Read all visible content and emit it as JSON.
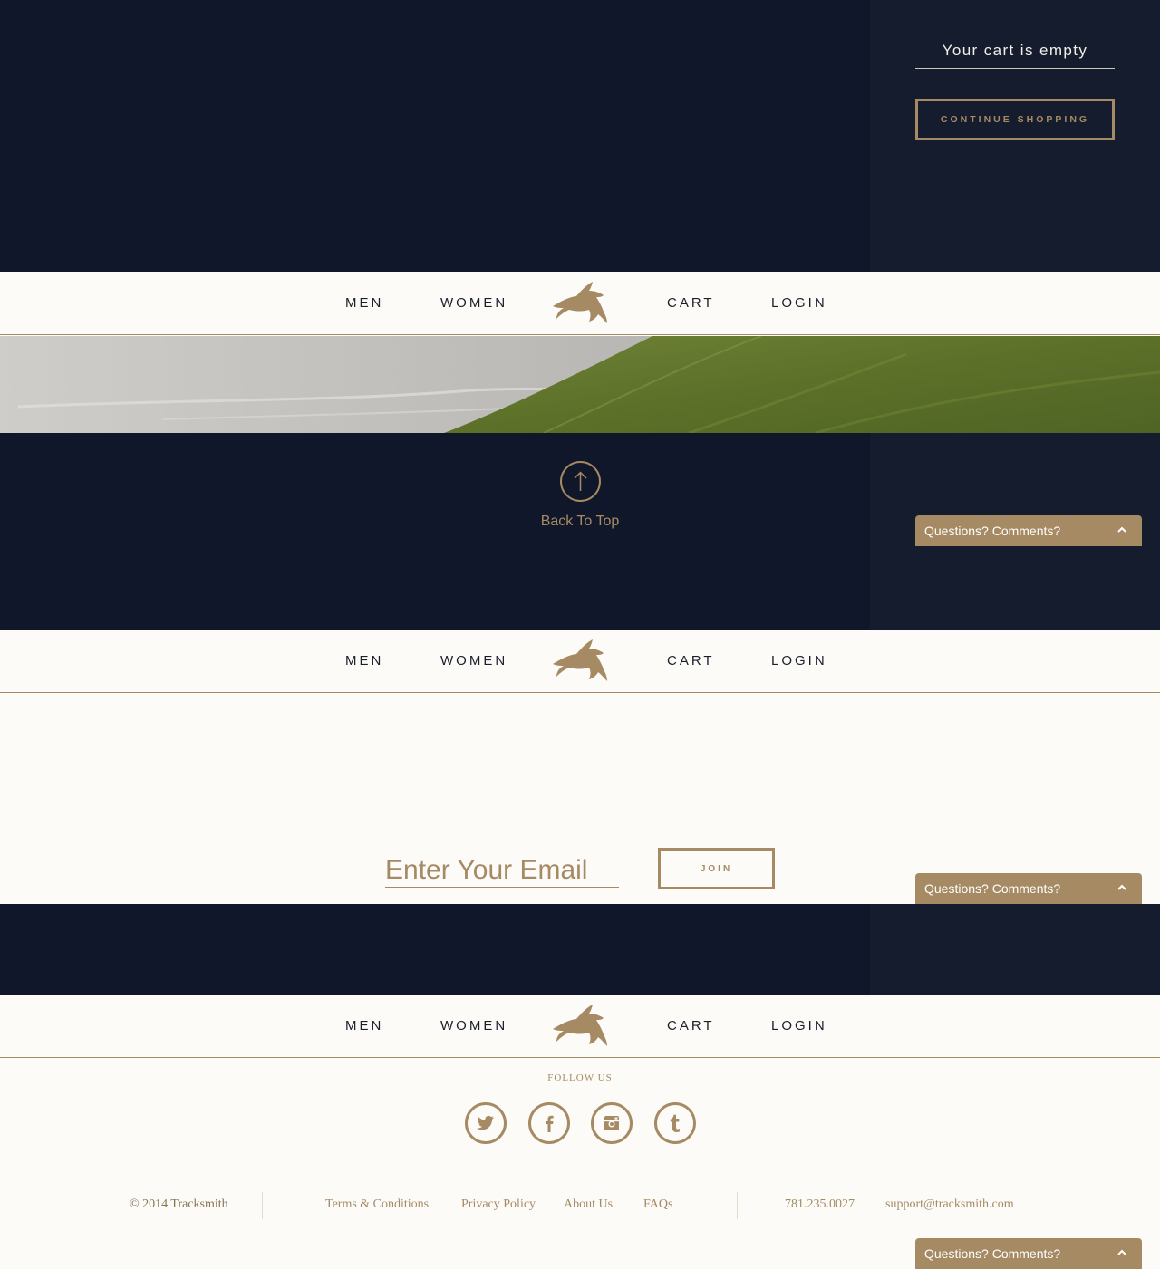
{
  "cart": {
    "empty_message": "Your cart is empty",
    "continue_label": "CONTINUE SHOPPING"
  },
  "nav": {
    "men": "MEN",
    "women": "WOMEN",
    "cart": "CART",
    "login": "LOGIN",
    "logo_icon": "leaping-hare-logo"
  },
  "back_to_top": {
    "label": "Back To Top",
    "icon": "arrow-up-circle-icon"
  },
  "feedback_widget": {
    "label": "Questions? Comments?",
    "icon": "chevron-up-icon"
  },
  "newsletter": {
    "placeholder": "Enter Your Email",
    "join_label": "JOIN"
  },
  "footer": {
    "follow_label": "FOLLOW US",
    "social": [
      {
        "name": "twitter",
        "icon": "twitter-icon"
      },
      {
        "name": "facebook",
        "icon": "facebook-icon"
      },
      {
        "name": "instagram",
        "icon": "instagram-icon"
      },
      {
        "name": "tumblr",
        "icon": "tumblr-icon"
      }
    ],
    "copyright": "© 2014 Tracksmith",
    "links": [
      "Terms & Conditions",
      "Privacy Policy",
      "About Us",
      "FAQs"
    ],
    "phone": "781.235.0027",
    "email": "support@tracksmith.com"
  },
  "colors": {
    "navy": "#11172a",
    "navy_side": "#151c2e",
    "gold": "#a58a63",
    "cream": "#fcfbf8"
  }
}
